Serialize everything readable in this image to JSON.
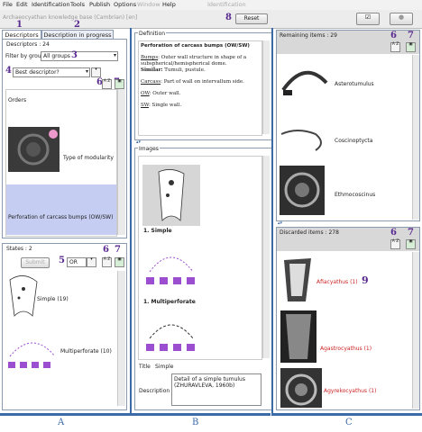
{
  "menu": {
    "items": [
      "File",
      "Edit",
      "Identification",
      "Tools",
      "Publish",
      "Options",
      "Window",
      "Help"
    ],
    "identification_label": "Identification"
  },
  "titlebar": {
    "app_title": "Archaeocyathan knowledge base (Cambrian) [en]",
    "reset_label": "Reset",
    "callout": "8"
  },
  "tabs": {
    "descriptors": "Descriptors",
    "in_progress": "Description in progress",
    "callout_1": "1",
    "callout_2": "2"
  },
  "descriptors": {
    "header": "Descriptors : 24",
    "filter_label": "Filter by group",
    "filter_value": "All groups",
    "sort_value": "Best descriptor?",
    "callout_3": "3",
    "callout_4": "4",
    "callout_6": "6",
    "callout_7": "7",
    "az_label": "A Z",
    "items": [
      "Orders",
      "Type of modularity",
      "Perforation of carcass bumps (OW/SW)"
    ]
  },
  "states": {
    "header": "States : 2",
    "submit_label": "Submit",
    "or_value": "OR",
    "callout_5": "5",
    "callout_6": "6",
    "callout_7": "7",
    "items": [
      "Simple (19)",
      "Multiperforate (10)"
    ]
  },
  "definition": {
    "header": "Definition",
    "title": "Perforation of carcass bumps (OW/SW)",
    "lines": [
      {
        "term": "Bumps",
        "text": ": Outer wall structure in shape of a subspherical/hemispherical dome."
      },
      {
        "term": "Similar:",
        "text": " Tumuli, pustule."
      },
      {
        "term": "Carcass",
        "text": ": Part of wall on intervallum side."
      },
      {
        "term": "OW",
        "text": ": Outer wall."
      },
      {
        "term": "SW",
        "text": ": Single wall."
      }
    ]
  },
  "images": {
    "header": "Images",
    "captions": [
      "1. Simple",
      "1. Multiperforate"
    ],
    "title_label": "Title",
    "title_value": "Simple",
    "description_label": "Description",
    "description_value": "Detail of a simple tumulus (ZHURAVLEVA, 1960b)"
  },
  "remaining": {
    "header": "Remaining items : 29",
    "callout_6": "6",
    "callout_7": "7",
    "items": [
      "Asterotumulus",
      "Coscinoptycta",
      "Ethmocoscinus"
    ]
  },
  "discarded": {
    "header": "Discarded items : 278",
    "callout_6": "6",
    "callout_7": "7",
    "callout_9": "9",
    "items": [
      "Afiacyathus (1)",
      "Agastrocyathus (1)",
      "Agyrekocyathus (1)"
    ]
  },
  "section_labels": {
    "a": "A",
    "b": "B",
    "c": "C"
  },
  "colors": {
    "accent_blue": "#3c6aa8",
    "callout_purple": "#5a2a90",
    "selection": "#c5cdf2",
    "state_purple": "#9b4fd0",
    "discarded_red": "#cc2222"
  }
}
